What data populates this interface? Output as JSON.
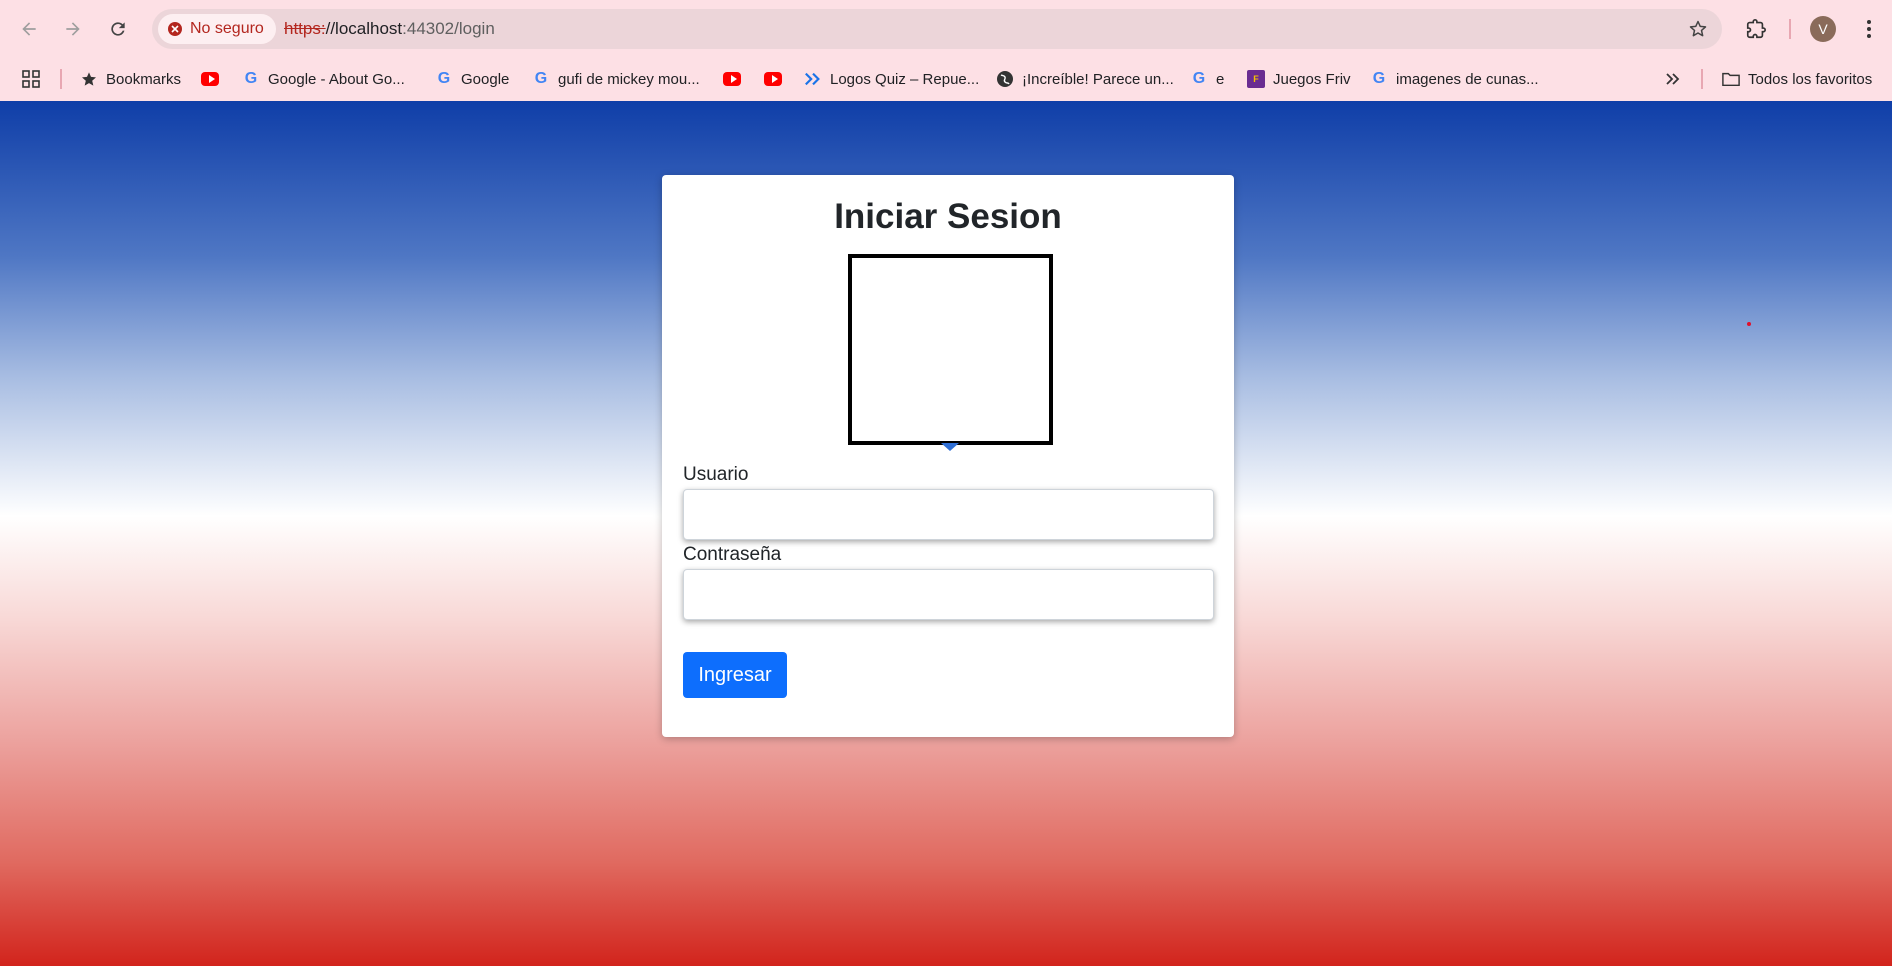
{
  "browser": {
    "security_label": "No seguro",
    "url_scheme": "https:",
    "url_rest": "//localhost",
    "url_port_path": ":44302/login",
    "avatar_letter": "V"
  },
  "bookmarks": [
    {
      "label": "Bookmarks",
      "icon": "star-icon"
    },
    {
      "label": "",
      "icon": "youtube-icon"
    },
    {
      "label": "Google - About Go...",
      "icon": "google-icon"
    },
    {
      "label": "Google",
      "icon": "google-icon"
    },
    {
      "label": "gufi de mickey mou...",
      "icon": "google-icon"
    },
    {
      "label": "",
      "icon": "youtube-icon"
    },
    {
      "label": "",
      "icon": "youtube-icon"
    },
    {
      "label": "Logos Quiz – Repue...",
      "icon": "double-chevron-icon"
    },
    {
      "label": "¡Increíble! Parece un...",
      "icon": "globe-icon"
    },
    {
      "label": "e",
      "icon": "google-icon"
    },
    {
      "label": "Juegos Friv",
      "icon": "friv-icon"
    },
    {
      "label": "imagenes de cunas...",
      "icon": "google-icon"
    }
  ],
  "bookmarks_all": "Todos los favoritos",
  "login": {
    "title": "Iniciar Sesion",
    "user_label": "Usuario",
    "user_value": "",
    "password_label": "Contraseña",
    "password_value": "",
    "submit_label": "Ingresar"
  },
  "colors": {
    "accent": "#0d6efd",
    "gradient_top": "#0f3ea8",
    "gradient_bottom": "#d2241c"
  }
}
